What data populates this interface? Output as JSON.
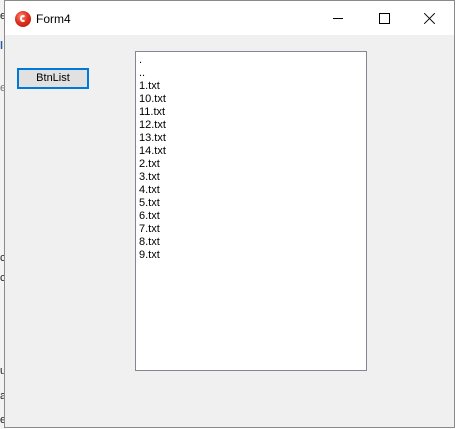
{
  "window": {
    "title": "Form4",
    "icon": "delphi-app-icon"
  },
  "titlebar_buttons": {
    "minimize": "minimize-icon",
    "maximize": "maximize-icon",
    "close": "close-icon"
  },
  "form": {
    "button_label": "BtnList",
    "list_items": [
      ".",
      "..",
      "1.txt",
      "10.txt",
      "11.txt",
      "12.txt",
      "13.txt",
      "14.txt",
      "2.txt",
      "3.txt",
      "4.txt",
      "5.txt",
      "6.txt",
      "7.txt",
      "8.txt",
      "9.txt"
    ]
  },
  "background": {
    "fragments": [
      "e",
      "l",
      "e",
      "c",
      "c",
      "ut",
      "a",
      "e"
    ]
  },
  "colors": {
    "focus_border": "#0078d7",
    "form_background": "#f0f0f0",
    "listbox_border": "#828790"
  }
}
